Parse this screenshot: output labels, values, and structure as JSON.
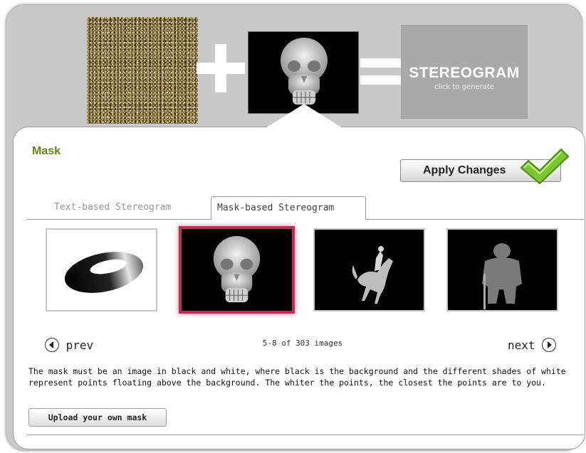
{
  "header": {
    "result_title": "STEREOGRAM",
    "result_subtitle": "click to generate"
  },
  "panel": {
    "heading": "Mask",
    "apply_button": "Apply Changes",
    "tabs": [
      {
        "label": "Text-based Stereogram",
        "active": false
      },
      {
        "label": "Mask-based Stereogram",
        "active": true
      }
    ],
    "thumbnails": [
      {
        "name": "torus"
      },
      {
        "name": "skull",
        "selected": true
      },
      {
        "name": "horse-rider"
      },
      {
        "name": "warrior"
      }
    ],
    "pager": {
      "prev_label": "prev",
      "next_label": "next",
      "count": "5-8 of 303 images"
    },
    "description": "The mask must be an image in black and white, where black is the background and the different shades of white represent points floating above the background. The whiter the points, the closest the points are to you.",
    "upload_button": "Upload your own mask"
  },
  "colors": {
    "heading_green": "#5a8a0f",
    "selected_border": "#c22c52",
    "check_green": "#7bc531"
  }
}
